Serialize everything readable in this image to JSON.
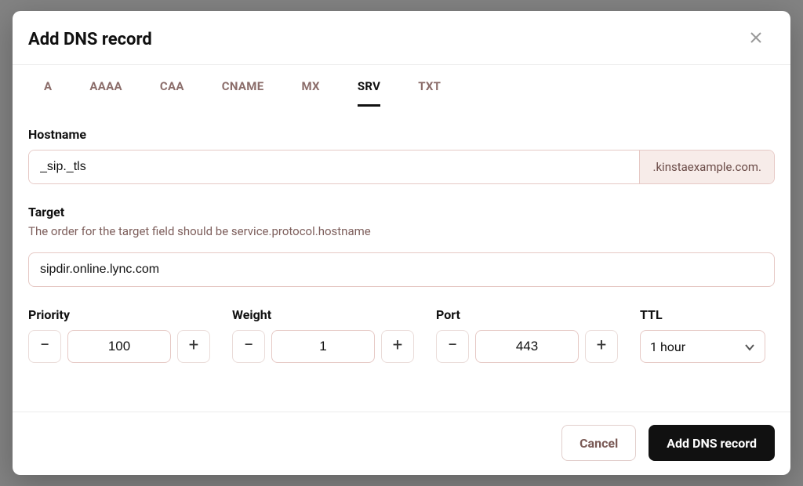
{
  "modal": {
    "title": "Add DNS record"
  },
  "tabs": [
    {
      "id": "a",
      "label": "A"
    },
    {
      "id": "aaaa",
      "label": "AAAA"
    },
    {
      "id": "caa",
      "label": "CAA"
    },
    {
      "id": "cname",
      "label": "CNAME"
    },
    {
      "id": "mx",
      "label": "MX"
    },
    {
      "id": "srv",
      "label": "SRV"
    },
    {
      "id": "txt",
      "label": "TXT"
    }
  ],
  "active_tab": "srv",
  "hostname": {
    "label": "Hostname",
    "value": "_sip._tls",
    "suffix": ".kinstaexample.com."
  },
  "target": {
    "label": "Target",
    "hint": "The order for the target field should be service.protocol.hostname",
    "value": "sipdir.online.lync.com"
  },
  "priority": {
    "label": "Priority",
    "value": "100"
  },
  "weight": {
    "label": "Weight",
    "value": "1"
  },
  "port": {
    "label": "Port",
    "value": "443"
  },
  "ttl": {
    "label": "TTL",
    "value": "1 hour"
  },
  "footer": {
    "cancel": "Cancel",
    "submit": "Add DNS record"
  }
}
